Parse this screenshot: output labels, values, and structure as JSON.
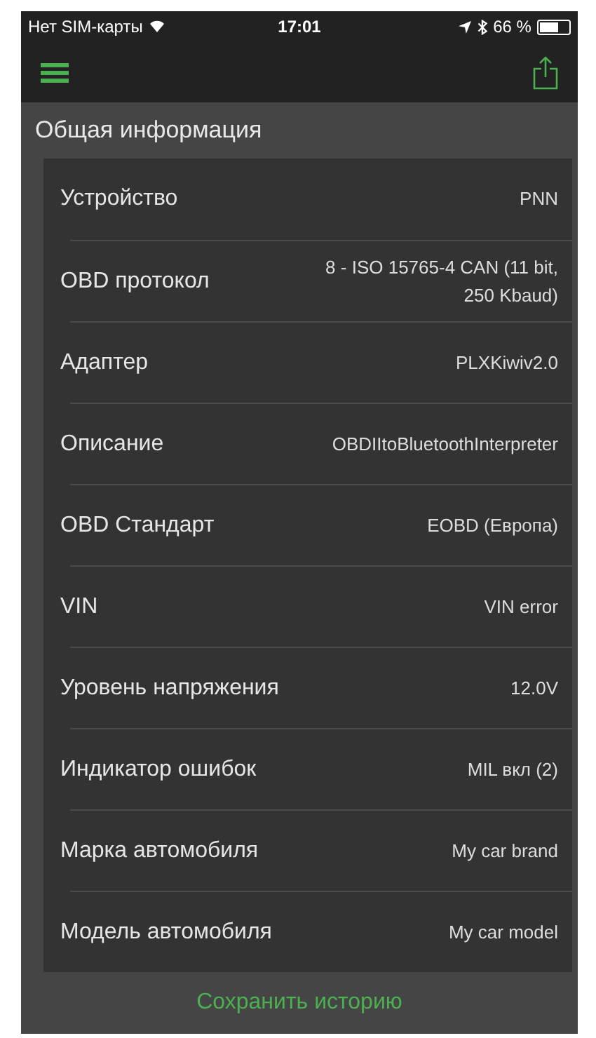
{
  "status_bar": {
    "carrier": "Нет SIM-карты",
    "time": "17:01",
    "battery": "66 %"
  },
  "section": {
    "title": "Общая информация"
  },
  "rows": [
    {
      "label": "Устройство",
      "value": "PNN"
    },
    {
      "label": "OBD протокол",
      "value": "8 - ISO 15765-4 CAN (11 bit, 250 Kbaud)"
    },
    {
      "label": "Адаптер",
      "value": "PLXKiwiv2.0"
    },
    {
      "label": "Описание",
      "value": "OBDIItoBluetoothInterpreter"
    },
    {
      "label": "OBD Стандарт",
      "value": "EOBD (Европа)"
    },
    {
      "label": "VIN",
      "value": "VIN error"
    },
    {
      "label": "Уровень напряжения",
      "value": "12.0V"
    },
    {
      "label": "Индикатор ошибок",
      "value": "MIL вкл (2)"
    },
    {
      "label": "Марка автомобиля",
      "value": "My car brand"
    },
    {
      "label": "Модель автомобиля",
      "value": "My car model"
    }
  ],
  "save_button": "Сохранить историю"
}
